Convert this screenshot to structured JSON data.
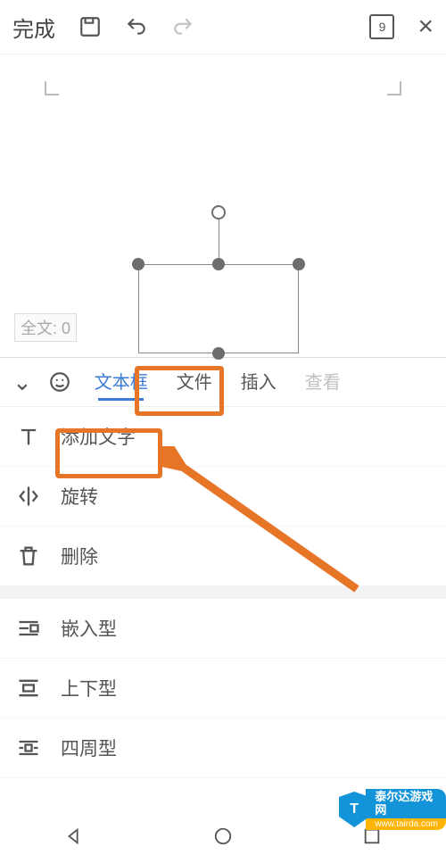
{
  "topbar": {
    "done_label": "完成",
    "page_count": "9"
  },
  "canvas": {
    "word_count_label": "全文: 0"
  },
  "panel": {
    "tabs": {
      "textbox": "文本框",
      "file": "文件",
      "insert": "插入",
      "view": "查看"
    },
    "actions": {
      "add_text": "添加文字",
      "rotate": "旋转",
      "delete": "删除"
    },
    "wrap": {
      "inline": "嵌入型",
      "top_bottom": "上下型",
      "around": "四周型"
    }
  },
  "watermark": {
    "glyph": "T",
    "line1": "泰尔达游戏网",
    "line2": "www.tairda.com"
  }
}
